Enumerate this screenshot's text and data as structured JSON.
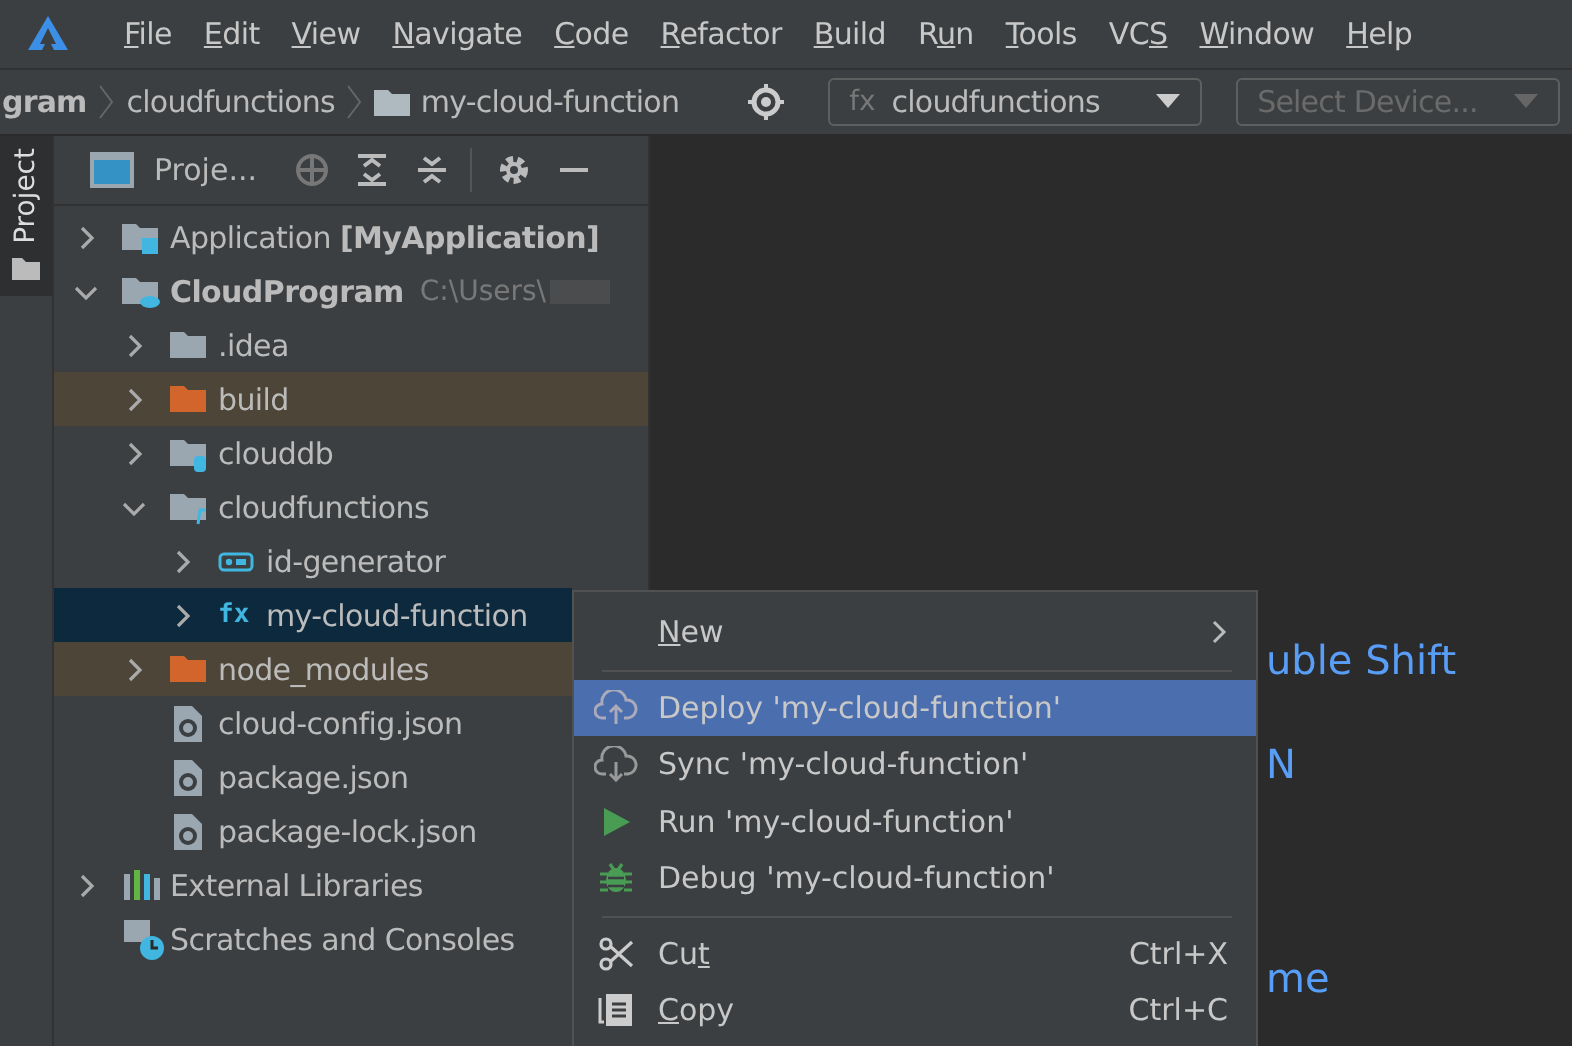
{
  "menu_bar": [
    {
      "key": "F",
      "post": "ile"
    },
    {
      "key": "E",
      "post": "dit"
    },
    {
      "key": "V",
      "post": "iew"
    },
    {
      "key": "N",
      "post": "avigate"
    },
    {
      "key": "C",
      "post": "ode"
    },
    {
      "key": "R",
      "post": "efactor"
    },
    {
      "key": "B",
      "post": "uild"
    },
    {
      "pre": "R",
      "key": "u",
      "post": "n"
    },
    {
      "key": "T",
      "post": "ools"
    },
    {
      "pre": "VC",
      "key": "S"
    },
    {
      "key": "W",
      "post": "indow"
    },
    {
      "key": "H",
      "post": "elp"
    }
  ],
  "breadcrumbs": [
    {
      "label": "gram",
      "bold": true,
      "folder": false
    },
    {
      "label": "cloudfunctions",
      "bold": false,
      "folder": false
    },
    {
      "label": "my-cloud-function",
      "bold": false,
      "folder": true
    }
  ],
  "run_config": {
    "prefix": "fx",
    "label": "cloudfunctions"
  },
  "device_select": {
    "placeholder": "Select Device...",
    "disabled": true
  },
  "side_tab": {
    "label": "Project",
    "selected": true
  },
  "project_panel": {
    "title": "Proje...",
    "tree": [
      {
        "kind": "module",
        "label": "Application **[MyApplication]**",
        "expanded": false,
        "bold": false
      },
      {
        "kind": "cloud-module",
        "label": "CloudProgram",
        "path": "C:\\Users\\",
        "expanded": true,
        "bold": true,
        "children": [
          {
            "kind": "folder",
            "label": ".idea",
            "expanded": false,
            "excluded": false,
            "selected": false
          },
          {
            "kind": "folder-excluded",
            "label": "build",
            "expanded": false,
            "excluded": true,
            "selected": false
          },
          {
            "kind": "folder-db",
            "label": "clouddb",
            "expanded": false,
            "excluded": false,
            "selected": false
          },
          {
            "kind": "folder-functions",
            "label": "cloudfunctions",
            "expanded": true,
            "excluded": false,
            "selected": false,
            "children": [
              {
                "kind": "obj",
                "label": "id-generator",
                "expanded": false,
                "selected": false
              },
              {
                "kind": "fx",
                "label": "my-cloud-function",
                "expanded": false,
                "selected": true
              }
            ]
          },
          {
            "kind": "folder-excluded",
            "label": "node_modules",
            "expanded": false,
            "excluded": true,
            "selected": false
          },
          {
            "kind": "json",
            "label": "cloud-config.json",
            "excluded": false,
            "selected": false
          },
          {
            "kind": "json",
            "label": "package.json",
            "excluded": false,
            "selected": false
          },
          {
            "kind": "json",
            "label": "package-lock.json",
            "excluded": false,
            "selected": false
          }
        ]
      },
      {
        "kind": "libraries",
        "label": "External Libraries",
        "expanded": false,
        "bold": false
      },
      {
        "kind": "scratches",
        "label": "Scratches and Consoles",
        "bold": false
      }
    ]
  },
  "editor_hints": [
    "uble Shift",
    "N",
    "me"
  ],
  "context_menu": [
    {
      "kind": "submenu",
      "key": "N",
      "post": "ew",
      "selected": false
    },
    {
      "kind": "separator"
    },
    {
      "kind": "deploy",
      "pre": "Deploy 'my-cloud-function'",
      "selected": true
    },
    {
      "kind": "sync",
      "pre": "Sync 'my-cloud-function'",
      "selected": false
    },
    {
      "kind": "run",
      "pre": "Run 'my-cloud-function'",
      "selected": false
    },
    {
      "kind": "debug",
      "pre": "Debug 'my-cloud-function'",
      "selected": false
    },
    {
      "kind": "separator"
    },
    {
      "kind": "cut",
      "pre": "Cu",
      "key": "t",
      "shortcut": "Ctrl+X",
      "selected": false
    },
    {
      "kind": "copy",
      "key": "C",
      "post": "opy",
      "shortcut": "Ctrl+C",
      "selected": false
    }
  ]
}
